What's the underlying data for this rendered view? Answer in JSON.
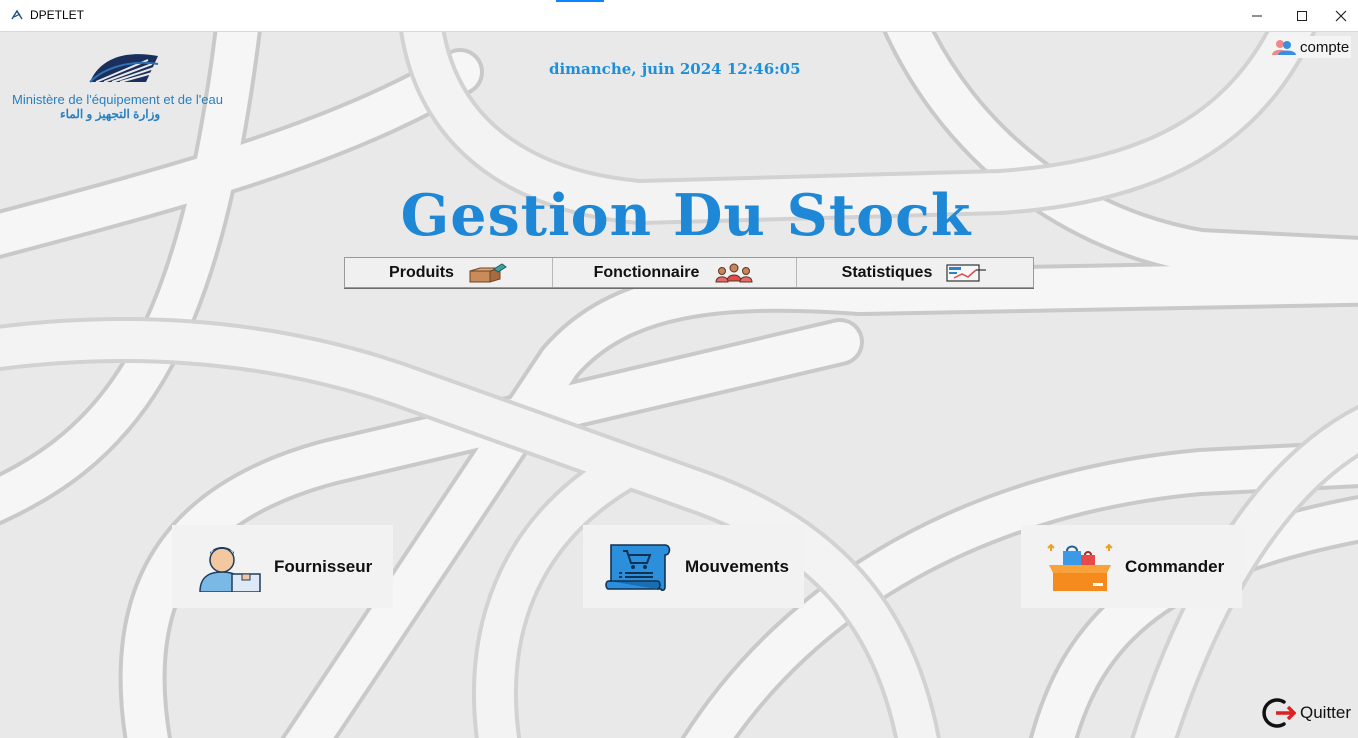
{
  "window": {
    "title": "DPETLET",
    "controls": [
      "minimize-icon",
      "maximize-icon",
      "close-icon"
    ]
  },
  "header": {
    "ministry_fr": "Ministère de l'équipement et de l'eau",
    "ministry_ar": "وزارة التجهيز و الماء",
    "datetime": "dimanche, juin 2024 12:46:05",
    "account_label": "compte"
  },
  "main": {
    "app_title": "Gestion Du Stock",
    "menu": [
      {
        "label": "Produits",
        "icon": "box-icon"
      },
      {
        "label": "Fonctionnaire",
        "icon": "team-icon"
      },
      {
        "label": "Statistiques",
        "icon": "chart-icon"
      }
    ],
    "tiles": [
      {
        "label": "Fournisseur",
        "icon": "supplier-icon"
      },
      {
        "label": "Mouvements",
        "icon": "shopping-list-icon"
      },
      {
        "label": "Commander",
        "icon": "order-box-icon"
      }
    ]
  },
  "footer": {
    "quit_label": "Quitter"
  },
  "colors": {
    "accent": "#1e88d6",
    "background": "#ececec",
    "tile": "#f2f2f2"
  }
}
